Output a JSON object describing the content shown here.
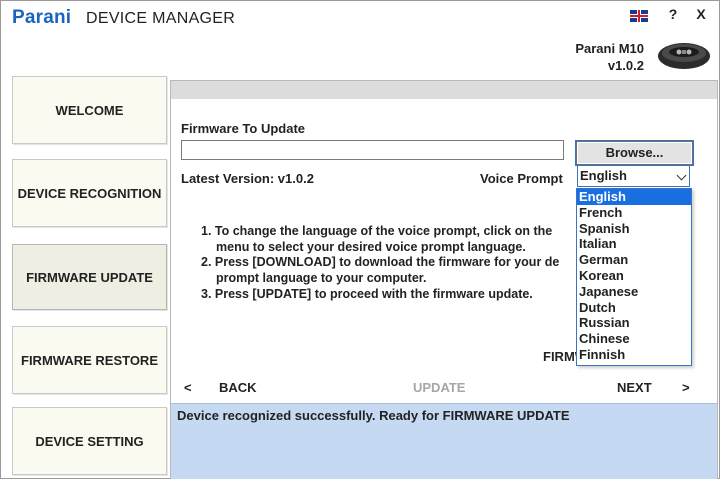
{
  "header": {
    "brand": "Parani",
    "title": "DEVICE MANAGER",
    "help_label": "?",
    "close_label": "X",
    "device_name": "Parani M10",
    "device_version": "v1.0.2"
  },
  "nav": {
    "items": [
      {
        "label": "WELCOME"
      },
      {
        "label": "DEVICE RECOGNITION"
      },
      {
        "label": "FIRMWARE UPDATE",
        "active": true
      },
      {
        "label": "FIRMWARE RESTORE"
      },
      {
        "label": "DEVICE SETTING"
      }
    ]
  },
  "main": {
    "firmware_label": "Firmware To Update",
    "firmware_path": "",
    "browse_label": "Browse...",
    "latest_version": "Latest Version: v1.0.2",
    "voice_prompt_label": "Voice Prompt",
    "voice_prompt_selected": "English",
    "instructions": [
      "1. To change the language of the voice prompt, click on the",
      "menu to select your desired voice prompt language.",
      "2. Press [DOWNLOAD] to download the firmware for your de",
      "prompt language to your computer.",
      "3. Press [UPDATE] to proceed with the firmware update."
    ],
    "firmware_partial": "FIRMW",
    "back_arrow": "<",
    "back_label": "BACK",
    "update_label": "UPDATE",
    "next_label": "NEXT",
    "next_arrow": ">",
    "status": "Device recognized successfully. Ready for FIRMWARE UPDATE"
  },
  "dropdown": {
    "options": [
      "English",
      "French",
      "Spanish",
      "Italian",
      "German",
      "Korean",
      "Japanese",
      "Dutch",
      "Russian",
      "Chinese",
      "Finnish"
    ],
    "selected_index": 0
  },
  "colors": {
    "brand": "#1a64c0",
    "status_bg": "#c5d9f2",
    "selection": "#1a6fe0"
  }
}
